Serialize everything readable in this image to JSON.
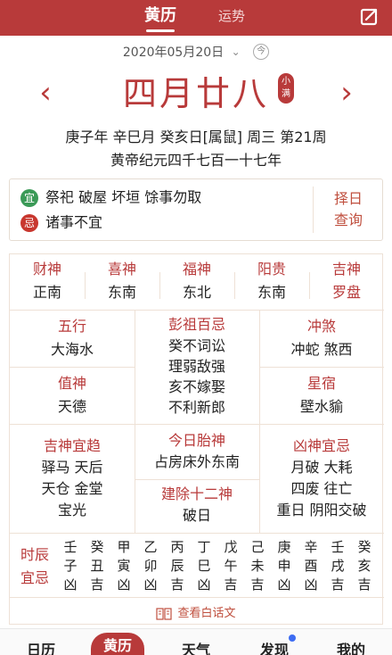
{
  "topbar": {
    "tab_huangli": "黄历",
    "tab_yunshi": "运势",
    "share_icon": "share-icon"
  },
  "datebar": {
    "date": "2020年05月20日",
    "chevron": "⌄",
    "today": "今"
  },
  "nav": {
    "prev": "‹",
    "next": "›"
  },
  "lunar_date": "四月廿八",
  "solar_term": "小满",
  "ganzhi": "庚子年 辛巳月 癸亥日[属鼠] 周三 第21周",
  "huangdi": "黄帝纪元四千七百一十七年",
  "yiji": {
    "yi_badge": "宜",
    "yi_text": "祭祀 破屋 坏垣 馀事勿取",
    "ji_badge": "忌",
    "ji_text": "诸事不宜",
    "zeri_1": "择日",
    "zeri_2": "查询"
  },
  "gods": [
    {
      "title": "财神",
      "value": "正南"
    },
    {
      "title": "喜神",
      "value": "东南"
    },
    {
      "title": "福神",
      "value": "东北"
    },
    {
      "title": "阳贵",
      "value": "东南"
    },
    {
      "title": "吉神",
      "value": "罗盘"
    }
  ],
  "left_col": [
    {
      "title": "五行",
      "value": "大海水"
    },
    {
      "title": "值神",
      "value": "天德"
    }
  ],
  "pengzu": {
    "title": "彭祖百忌",
    "lines": [
      "癸不词讼",
      "理弱敌强",
      "亥不嫁娶",
      "不利新郎"
    ]
  },
  "right_col": [
    {
      "title": "冲煞",
      "value": "冲蛇 煞西"
    },
    {
      "title": "星宿",
      "value": "壁水貐"
    }
  ],
  "jishen": {
    "title": "吉神宜趋",
    "lines": [
      "驿马 天后",
      "天仓 金堂",
      "宝光"
    ]
  },
  "taishen": {
    "title": "今日胎神",
    "value": "占房床外东南"
  },
  "jianchu": {
    "title": "建除十二神",
    "value": "破日"
  },
  "xiongshen": {
    "title": "凶神宜忌",
    "lines": [
      "月破 大耗",
      "四废 往亡",
      "重日 阴阳交破"
    ]
  },
  "shichen": {
    "label_1": "时辰",
    "label_2": "宜忌",
    "hours": [
      {
        "gan": "壬",
        "zhi": "子",
        "luck": "凶"
      },
      {
        "gan": "癸",
        "zhi": "丑",
        "luck": "吉"
      },
      {
        "gan": "甲",
        "zhi": "寅",
        "luck": "凶"
      },
      {
        "gan": "乙",
        "zhi": "卯",
        "luck": "凶"
      },
      {
        "gan": "丙",
        "zhi": "辰",
        "luck": "吉"
      },
      {
        "gan": "丁",
        "zhi": "巳",
        "luck": "凶"
      },
      {
        "gan": "戊",
        "zhi": "午",
        "luck": "吉"
      },
      {
        "gan": "己",
        "zhi": "未",
        "luck": "吉"
      },
      {
        "gan": "庚",
        "zhi": "申",
        "luck": "凶"
      },
      {
        "gan": "辛",
        "zhi": "酉",
        "luck": "凶"
      },
      {
        "gan": "壬",
        "zhi": "戌",
        "luck": "吉"
      },
      {
        "gan": "癸",
        "zhi": "亥",
        "luck": "吉"
      }
    ]
  },
  "baihua_link": "查看白话文",
  "bottomnav": {
    "rili": "日历",
    "huangli": "黄历",
    "tianqi": "天气",
    "faxian": "发现",
    "wode": "我的"
  },
  "colors": {
    "brand_red": "#b83a3a",
    "yi_green": "#3b9a57",
    "ji_red": "#c8372f",
    "dot_blue": "#3d6cf2"
  }
}
